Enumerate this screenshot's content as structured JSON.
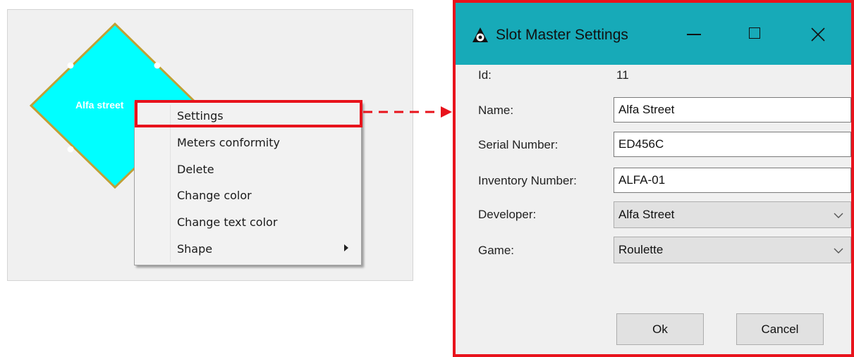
{
  "node": {
    "label": "Alfa street",
    "fill": "#00ffff",
    "border": "#c0a036"
  },
  "context_menu": {
    "items": [
      {
        "label": "Settings"
      },
      {
        "label": "Meters conformity"
      },
      {
        "label": "Delete"
      },
      {
        "label": "Change color"
      },
      {
        "label": "Change text color"
      },
      {
        "label": "Shape",
        "has_submenu": true
      }
    ]
  },
  "dialog": {
    "title": "Slot Master Settings",
    "titlebar_color": "#17aab8",
    "highlight_color": "#e8131c",
    "id_label": "Id:",
    "id_value": "11",
    "name_label": "Name:",
    "name_value": "Alfa Street",
    "serial_label": "Serial Number:",
    "serial_value": "ED456C",
    "inventory_label": "Inventory Number:",
    "inventory_value": "ALFA-01",
    "developer_label": "Developer:",
    "developer_value": "Alfa Street",
    "game_label": "Game:",
    "game_value": "Roulette",
    "ok_label": "Ok",
    "cancel_label": "Cancel"
  }
}
